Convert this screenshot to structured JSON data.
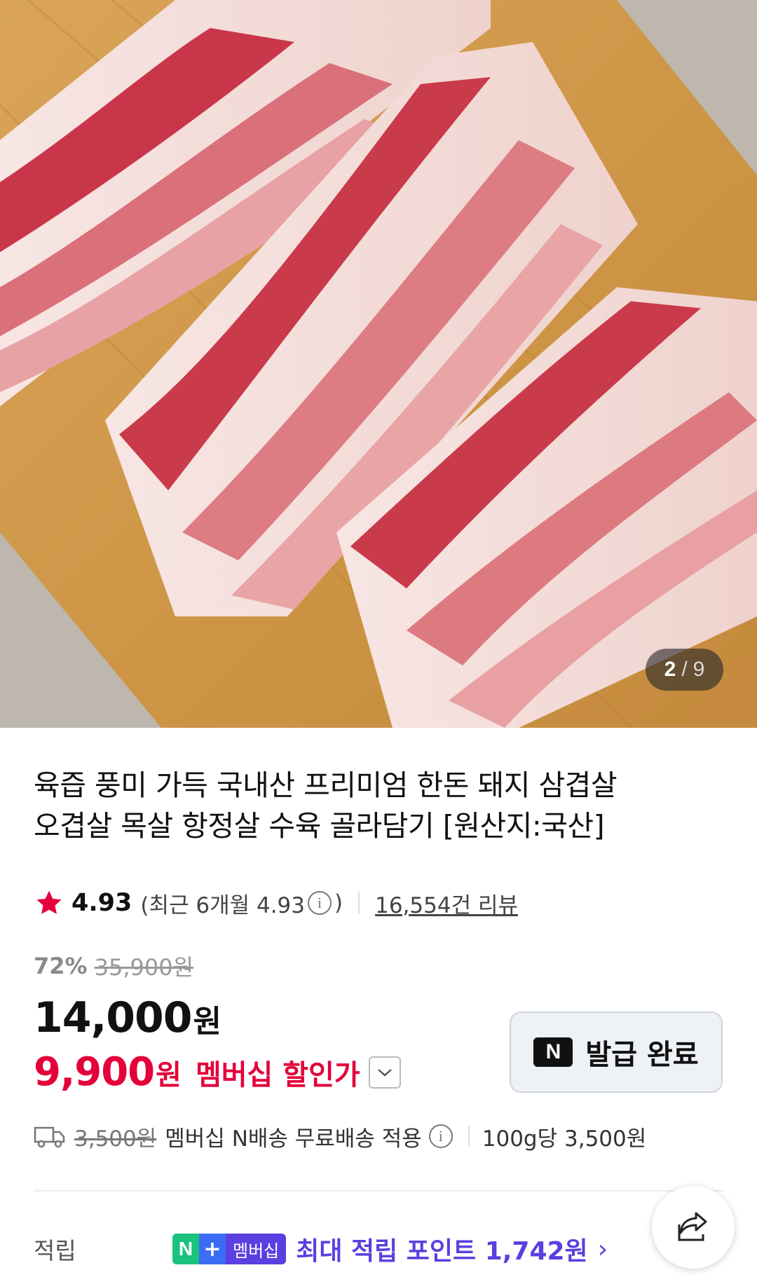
{
  "gallery": {
    "current": "2",
    "separator": "/",
    "total": "9"
  },
  "product": {
    "title_line1": "육즙 풍미 가득 국내산 프리미엄 한돈 돼지 삼겹살",
    "title_line2": "오겹살 목살 항정살 수육 골라담기 [원산지:국산]"
  },
  "rating": {
    "score": "4.93",
    "recent_prefix": "(최근 6개월 4.93",
    "recent_suffix": ")",
    "reviews": "16,554건 리뷰",
    "star_color": "#e4003a"
  },
  "price": {
    "discount_rate": "72%",
    "original": "35,900원",
    "sale": "14,000",
    "sale_unit": "원",
    "member_price": "9,900",
    "member_unit": "원",
    "member_label": "멤버십 할인가"
  },
  "coupon": {
    "icon": "N",
    "label": "발급 완료"
  },
  "delivery": {
    "original_fee": "3,500원",
    "text": "멤버십 N배송 무료배송 적용",
    "unit_price": "100g당 3,500원"
  },
  "points": {
    "label": "적립",
    "badge_n": "N",
    "badge_plus": "+",
    "badge_text": "멤버십",
    "text": "최대 적립 포인트 1,742원",
    "chevron": "›"
  },
  "colors": {
    "accent_red": "#e4003a",
    "membership_purple": "#5b3fe0",
    "naver_green": "#19c37d"
  }
}
